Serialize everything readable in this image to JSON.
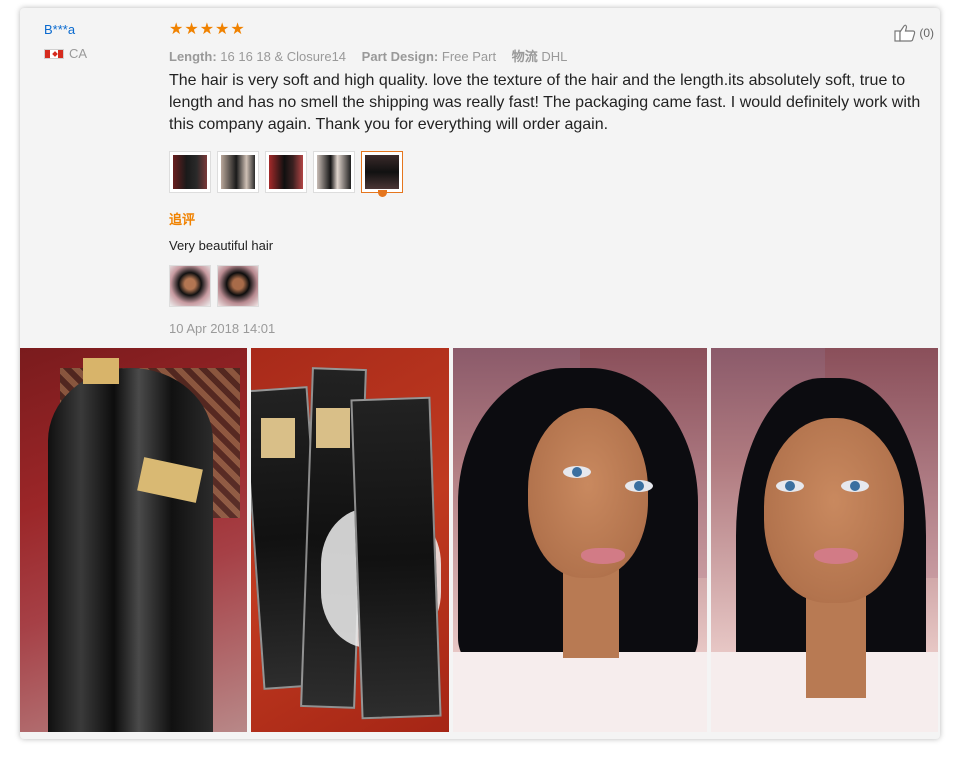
{
  "reviewer": {
    "name": "B***a",
    "country": "CA"
  },
  "rating": {
    "stars": 5
  },
  "specs": [
    {
      "label": "Length:",
      "value": "16 16 18 & Closure14"
    },
    {
      "label": "Part Design:",
      "value": "Free Part"
    },
    {
      "label": "物流",
      "value": "DHL"
    }
  ],
  "like": {
    "count": "(0)",
    "icon": "thumbs-up-icon"
  },
  "review_text": "The hair is very soft and high quality. love the texture of the hair and the length.its absolutely soft, true to length and has no smell the shipping was really fast! The packaging came fast. I would definitely work with this company again. Thank you for everything will order again.",
  "review_thumbnails": {
    "count": 5,
    "selected_index": 4
  },
  "followup": {
    "label": "追评",
    "text": "Very beautiful hair",
    "thumbnail_count": 2
  },
  "date": "10 Apr 2018 14:01",
  "colors": {
    "accent": "#f08200",
    "name_link": "#0a6acf",
    "card_bg": "#f4f4f4"
  }
}
